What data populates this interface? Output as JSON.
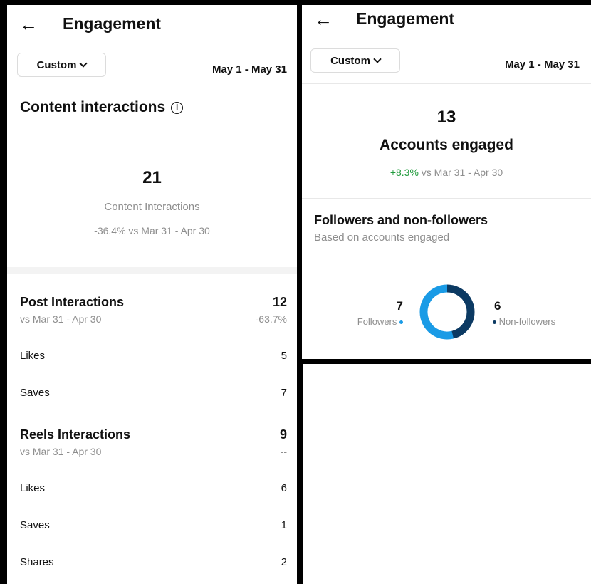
{
  "colors": {
    "followers": "#1a9be6",
    "non_followers": "#0c3a63",
    "positive": "#1f9a3b",
    "muted": "#8e8e8e"
  },
  "left": {
    "title": "Engagement",
    "filter_label": "Custom",
    "date_range": "May 1 - May 31",
    "section_title": "Content interactions",
    "total": "21",
    "total_label": "Content Interactions",
    "comparison": "-36.4% vs Mar 31 - Apr 30",
    "post": {
      "title": "Post Interactions",
      "value": "12",
      "sub": "vs Mar 31 - Apr 30",
      "change": "-63.7%",
      "rows": [
        {
          "label": "Likes",
          "value": "5"
        },
        {
          "label": "Saves",
          "value": "7"
        }
      ]
    },
    "reels": {
      "title": "Reels Interactions",
      "value": "9",
      "sub": "vs Mar 31 - Apr 30",
      "change": "--",
      "rows": [
        {
          "label": "Likes",
          "value": "6"
        },
        {
          "label": "Saves",
          "value": "1"
        },
        {
          "label": "Shares",
          "value": "2"
        }
      ]
    }
  },
  "right": {
    "title": "Engagement",
    "filter_label": "Custom",
    "date_range": "May 1 - May 31",
    "accounts_count": "13",
    "accounts_label": "Accounts engaged",
    "change_pct": "+8.3%",
    "change_rest": " vs Mar 31 - Apr 30",
    "breakdown_title": "Followers and non-followers",
    "breakdown_sub": "Based on accounts engaged",
    "followers_count": "7",
    "followers_label": "Followers",
    "non_followers_count": "6",
    "non_followers_label": "Non-followers",
    "donut": {
      "followers": 7,
      "non_followers": 6
    }
  }
}
